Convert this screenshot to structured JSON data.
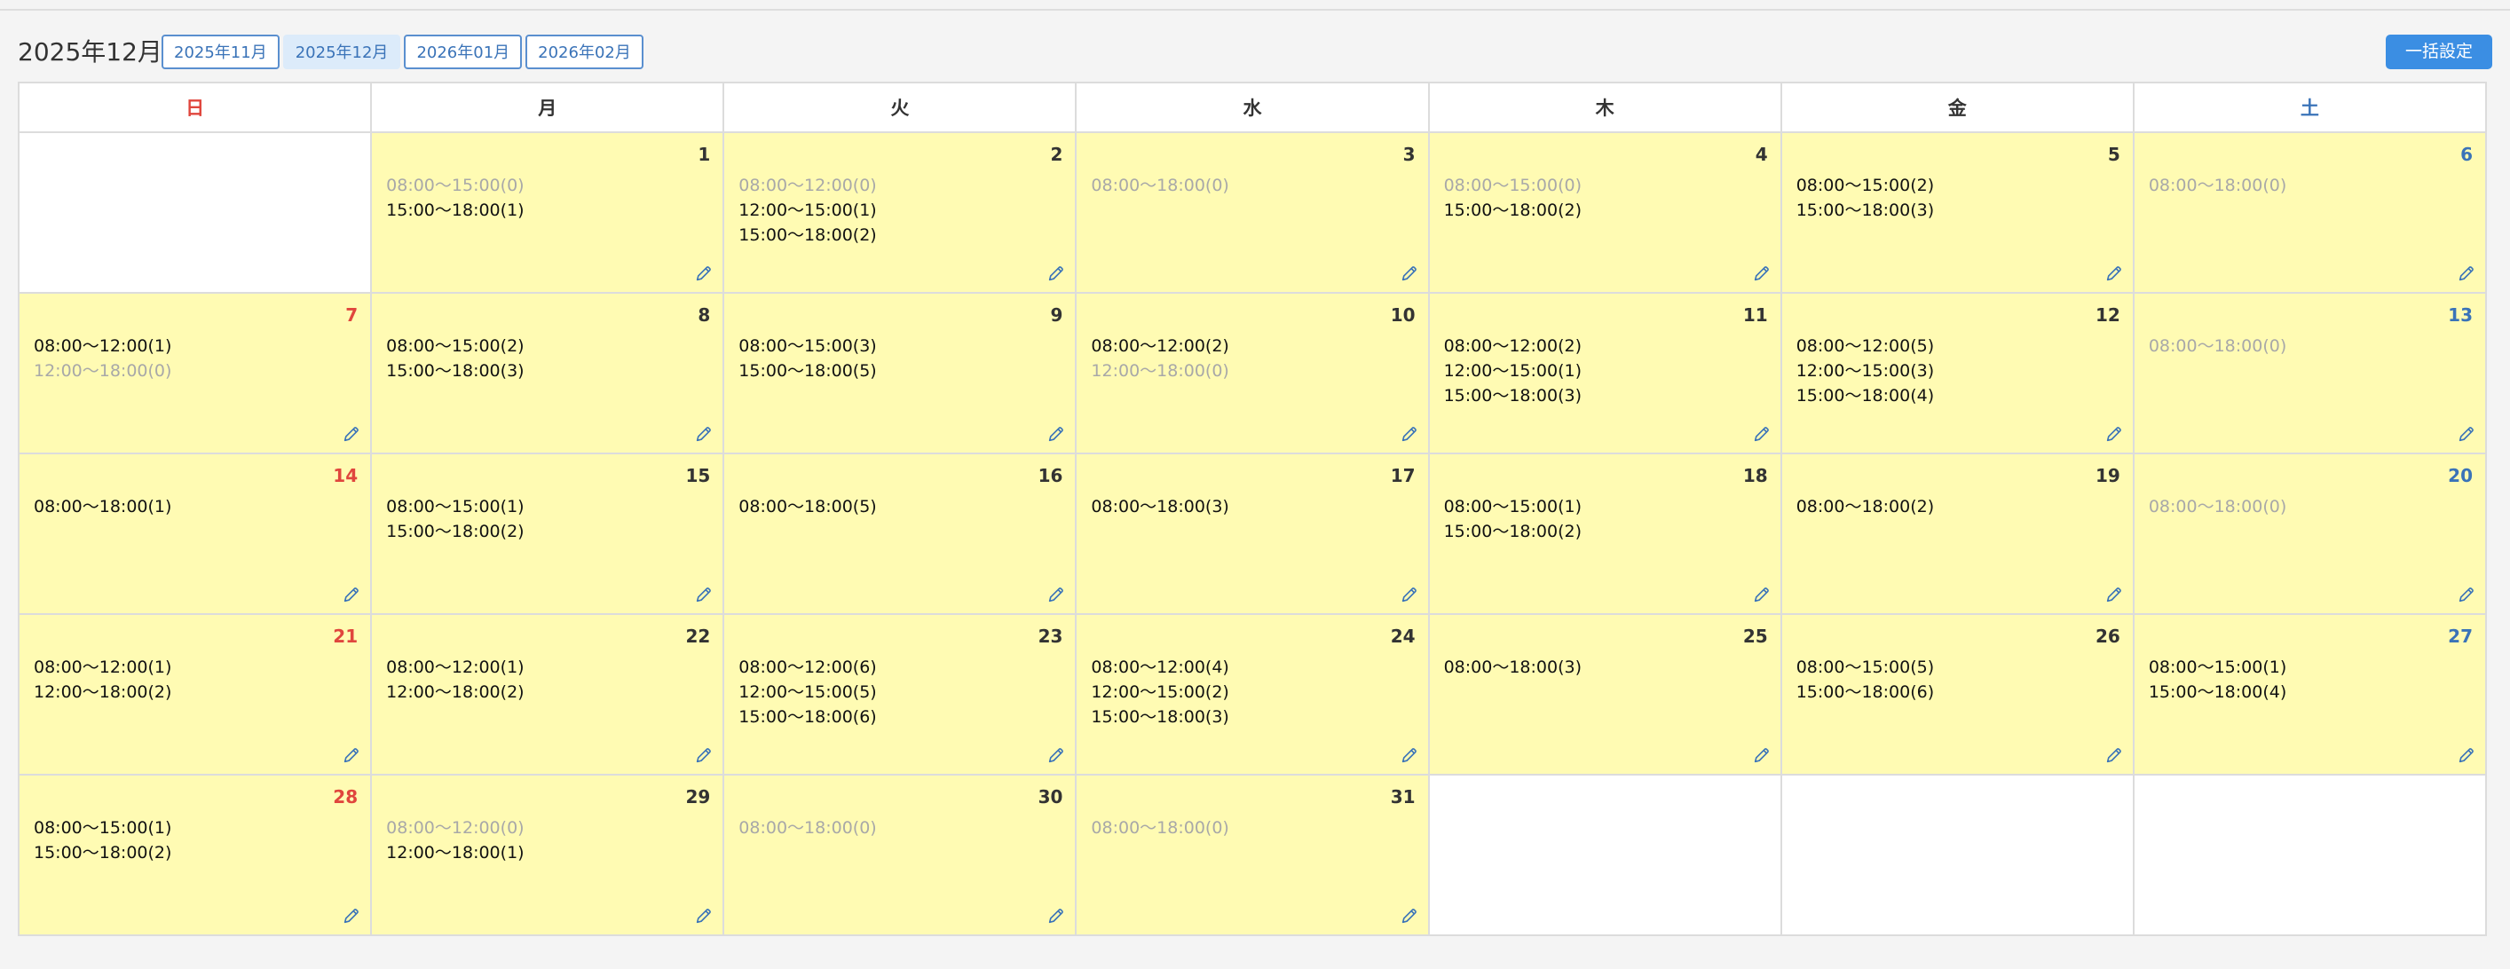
{
  "header": {
    "title": "2025年12月",
    "months": [
      "2025年11月",
      "2025年12月",
      "2026年01月",
      "2026年02月"
    ],
    "active_month": 1,
    "bulk_button": "一括設定"
  },
  "colors": {
    "sunday": "#e0463d",
    "saturday": "#3a73b8",
    "cell_with_slots": "#fffbb3",
    "zero_slot_text": "#a8a8a8",
    "accent_button": "#3b8ee3"
  },
  "calendar": {
    "weekdays": [
      "日",
      "月",
      "火",
      "水",
      "木",
      "金",
      "土"
    ],
    "weeks": [
      [
        null,
        {
          "day": "1",
          "slots": [
            {
              "text": "08:00〜15:00(0)",
              "count": 0
            },
            {
              "text": "15:00〜18:00(1)",
              "count": 1
            }
          ]
        },
        {
          "day": "2",
          "slots": [
            {
              "text": "08:00〜12:00(0)",
              "count": 0
            },
            {
              "text": "12:00〜15:00(1)",
              "count": 1
            },
            {
              "text": "15:00〜18:00(2)",
              "count": 2
            }
          ]
        },
        {
          "day": "3",
          "slots": [
            {
              "text": "08:00〜18:00(0)",
              "count": 0
            }
          ]
        },
        {
          "day": "4",
          "slots": [
            {
              "text": "08:00〜15:00(0)",
              "count": 0
            },
            {
              "text": "15:00〜18:00(2)",
              "count": 2
            }
          ]
        },
        {
          "day": "5",
          "slots": [
            {
              "text": "08:00〜15:00(2)",
              "count": 2
            },
            {
              "text": "15:00〜18:00(3)",
              "count": 3
            }
          ]
        },
        {
          "day": "6",
          "slots": [
            {
              "text": "08:00〜18:00(0)",
              "count": 0
            }
          ]
        }
      ],
      [
        {
          "day": "7",
          "slots": [
            {
              "text": "08:00〜12:00(1)",
              "count": 1
            },
            {
              "text": "12:00〜18:00(0)",
              "count": 0
            }
          ]
        },
        {
          "day": "8",
          "slots": [
            {
              "text": "08:00〜15:00(2)",
              "count": 2
            },
            {
              "text": "15:00〜18:00(3)",
              "count": 3
            }
          ]
        },
        {
          "day": "9",
          "slots": [
            {
              "text": "08:00〜15:00(3)",
              "count": 3
            },
            {
              "text": "15:00〜18:00(5)",
              "count": 5
            }
          ]
        },
        {
          "day": "10",
          "slots": [
            {
              "text": "08:00〜12:00(2)",
              "count": 2
            },
            {
              "text": "12:00〜18:00(0)",
              "count": 0
            }
          ]
        },
        {
          "day": "11",
          "slots": [
            {
              "text": "08:00〜12:00(2)",
              "count": 2
            },
            {
              "text": "12:00〜15:00(1)",
              "count": 1
            },
            {
              "text": "15:00〜18:00(3)",
              "count": 3
            }
          ]
        },
        {
          "day": "12",
          "slots": [
            {
              "text": "08:00〜12:00(5)",
              "count": 5
            },
            {
              "text": "12:00〜15:00(3)",
              "count": 3
            },
            {
              "text": "15:00〜18:00(4)",
              "count": 4
            }
          ]
        },
        {
          "day": "13",
          "slots": [
            {
              "text": "08:00〜18:00(0)",
              "count": 0
            }
          ]
        }
      ],
      [
        {
          "day": "14",
          "slots": [
            {
              "text": "08:00〜18:00(1)",
              "count": 1
            }
          ]
        },
        {
          "day": "15",
          "slots": [
            {
              "text": "08:00〜15:00(1)",
              "count": 1
            },
            {
              "text": "15:00〜18:00(2)",
              "count": 2
            }
          ]
        },
        {
          "day": "16",
          "slots": [
            {
              "text": "08:00〜18:00(5)",
              "count": 5
            }
          ]
        },
        {
          "day": "17",
          "slots": [
            {
              "text": "08:00〜18:00(3)",
              "count": 3
            }
          ]
        },
        {
          "day": "18",
          "slots": [
            {
              "text": "08:00〜15:00(1)",
              "count": 1
            },
            {
              "text": "15:00〜18:00(2)",
              "count": 2
            }
          ]
        },
        {
          "day": "19",
          "slots": [
            {
              "text": "08:00〜18:00(2)",
              "count": 2
            }
          ]
        },
        {
          "day": "20",
          "slots": [
            {
              "text": "08:00〜18:00(0)",
              "count": 0
            }
          ]
        }
      ],
      [
        {
          "day": "21",
          "slots": [
            {
              "text": "08:00〜12:00(1)",
              "count": 1
            },
            {
              "text": "12:00〜18:00(2)",
              "count": 2
            }
          ]
        },
        {
          "day": "22",
          "slots": [
            {
              "text": "08:00〜12:00(1)",
              "count": 1
            },
            {
              "text": "12:00〜18:00(2)",
              "count": 2
            }
          ]
        },
        {
          "day": "23",
          "slots": [
            {
              "text": "08:00〜12:00(6)",
              "count": 6
            },
            {
              "text": "12:00〜15:00(5)",
              "count": 5
            },
            {
              "text": "15:00〜18:00(6)",
              "count": 6
            }
          ]
        },
        {
          "day": "24",
          "slots": [
            {
              "text": "08:00〜12:00(4)",
              "count": 4
            },
            {
              "text": "12:00〜15:00(2)",
              "count": 2
            },
            {
              "text": "15:00〜18:00(3)",
              "count": 3
            }
          ]
        },
        {
          "day": "25",
          "slots": [
            {
              "text": "08:00〜18:00(3)",
              "count": 3
            }
          ]
        },
        {
          "day": "26",
          "slots": [
            {
              "text": "08:00〜15:00(5)",
              "count": 5
            },
            {
              "text": "15:00〜18:00(6)",
              "count": 6
            }
          ]
        },
        {
          "day": "27",
          "slots": [
            {
              "text": "08:00〜15:00(1)",
              "count": 1
            },
            {
              "text": "15:00〜18:00(4)",
              "count": 4
            }
          ]
        }
      ],
      [
        {
          "day": "28",
          "slots": [
            {
              "text": "08:00〜15:00(1)",
              "count": 1
            },
            {
              "text": "15:00〜18:00(2)",
              "count": 2
            }
          ]
        },
        {
          "day": "29",
          "slots": [
            {
              "text": "08:00〜12:00(0)",
              "count": 0
            },
            {
              "text": "12:00〜18:00(1)",
              "count": 1
            }
          ]
        },
        {
          "day": "30",
          "slots": [
            {
              "text": "08:00〜18:00(0)",
              "count": 0
            }
          ]
        },
        {
          "day": "31",
          "slots": [
            {
              "text": "08:00〜18:00(0)",
              "count": 0
            }
          ]
        },
        null,
        null,
        null
      ]
    ]
  },
  "icons": {
    "edit": "pencil-icon"
  }
}
